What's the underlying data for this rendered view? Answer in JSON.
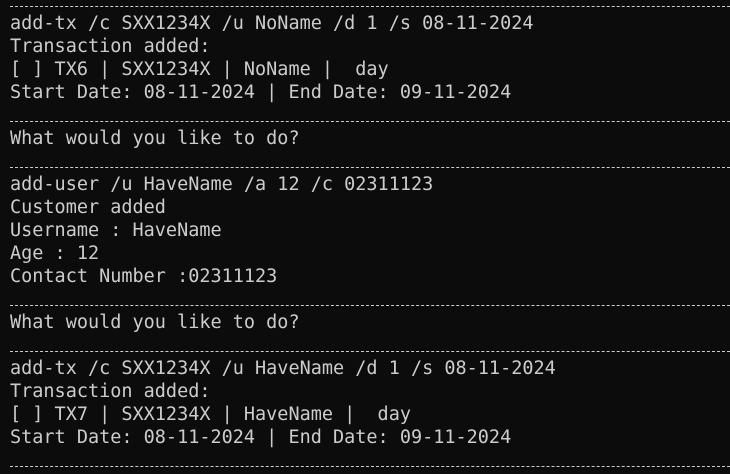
{
  "terminal": {
    "lines": [
      "add-tx /c SXX1234X /u NoName /d 1 /s 08-11-2024",
      "Transaction added:",
      "[ ] TX6 | SXX1234X | NoName |  day",
      "Start Date: 08-11-2024 | End Date: 09-11-2024",
      "What would you like to do?",
      "add-user /u HaveName /a 12 /c 02311123",
      "Customer added",
      "Username : HaveName",
      "Age : 12",
      "Contact Number :02311123",
      "What would you like to do?",
      "add-tx /c SXX1234X /u HaveName /d 1 /s 08-11-2024",
      "Transaction added:",
      "[ ] TX7 | SXX1234X | HaveName |  day",
      "Start Date: 08-11-2024 | End Date: 09-11-2024"
    ]
  },
  "colors": {
    "background": "#0c0c0c",
    "foreground": "#cccccc"
  }
}
